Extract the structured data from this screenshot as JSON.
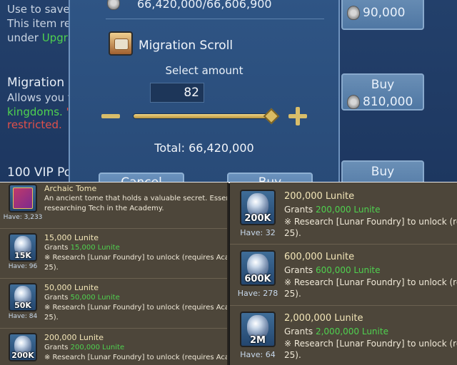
{
  "background_store": {
    "line1": "Use to save a",
    "line2": "This item rec",
    "line3_prefix": "under ",
    "line3_green": "Upgra",
    "item2_title": "Migration S",
    "item2_line1": "Allows you t",
    "item2_line2_green": "kingdoms.",
    "item2_line2_red": " \"",
    "item2_line3_red": "restricted.",
    "item3_title": "100 VIP Po",
    "buttons": [
      {
        "label": "Buy",
        "price": "90,000"
      },
      {
        "label": "Buy",
        "price": "810,000"
      },
      {
        "label": "Buy",
        "price": ""
      }
    ]
  },
  "modal": {
    "top_value": "66,420,000/66,606,900",
    "title": "Migration Scroll",
    "select_label": "Select amount",
    "amount": "82",
    "slider_fraction": 0.997,
    "total_label": "Total: 66,420,000",
    "cancel_label": "Cancel",
    "buy_label": "Buy"
  },
  "left_list": [
    {
      "icon": "book-icon",
      "icon_label": "",
      "have": "Have: 3,233",
      "title": "Archaic Tome",
      "desc1": "An ancient tome that holds a valuable secret. Essential",
      "desc2": "researching Tech in the Academy.",
      "grants_prefix": "",
      "grants_green": ""
    },
    {
      "icon": "lunite-gem-icon",
      "icon_label": "15K",
      "have": "Have: 96",
      "title": "15,000 Lunite",
      "grants_prefix": "Grants ",
      "grants_green": "15,000 Lunite",
      "desc1": "※ Research [Lunar Foundry] to unlock (requires Acade",
      "desc2": "25)."
    },
    {
      "icon": "lunite-gem-icon",
      "icon_label": "50K",
      "have": "Have: 84",
      "title": "50,000 Lunite",
      "grants_prefix": "Grants ",
      "grants_green": "50,000 Lunite",
      "desc1": "※ Research [Lunar Foundry] to unlock (requires Acade",
      "desc2": "25)."
    },
    {
      "icon": "lunite-gem-icon",
      "icon_label": "200K",
      "have": "",
      "title": "200,000 Lunite",
      "grants_prefix": "Grants ",
      "grants_green": "200,000 Lunite",
      "desc1": "※ Research [Lunar Foundry] to unlock (requires Acade",
      "desc2": ""
    }
  ],
  "right_list": [
    {
      "icon": "lunite-gem-icon",
      "icon_label": "200K",
      "have": "Have: 32",
      "title": "200,000 Lunite",
      "grants_prefix": "Grants ",
      "grants_green": "200,000 Lunite",
      "desc1": "※ Research [Lunar Foundry] to unlock (requ",
      "desc2": "25)."
    },
    {
      "icon": "lunite-gem-icon",
      "icon_label": "600K",
      "have": "Have: 278",
      "title": "600,000 Lunite",
      "grants_prefix": "Grants ",
      "grants_green": "600,000 Lunite",
      "desc1": "※ Research [Lunar Foundry] to unlock (requ",
      "desc2": "25)."
    },
    {
      "icon": "lunite-gem-icon",
      "icon_label": "2M",
      "have": "Have: 64",
      "title": "2,000,000 Lunite",
      "grants_prefix": "Grants ",
      "grants_green": "2,000,000 Lunite",
      "desc1": "※ Research [Lunar Foundry] to unlock (requ",
      "desc2": "25)."
    }
  ]
}
